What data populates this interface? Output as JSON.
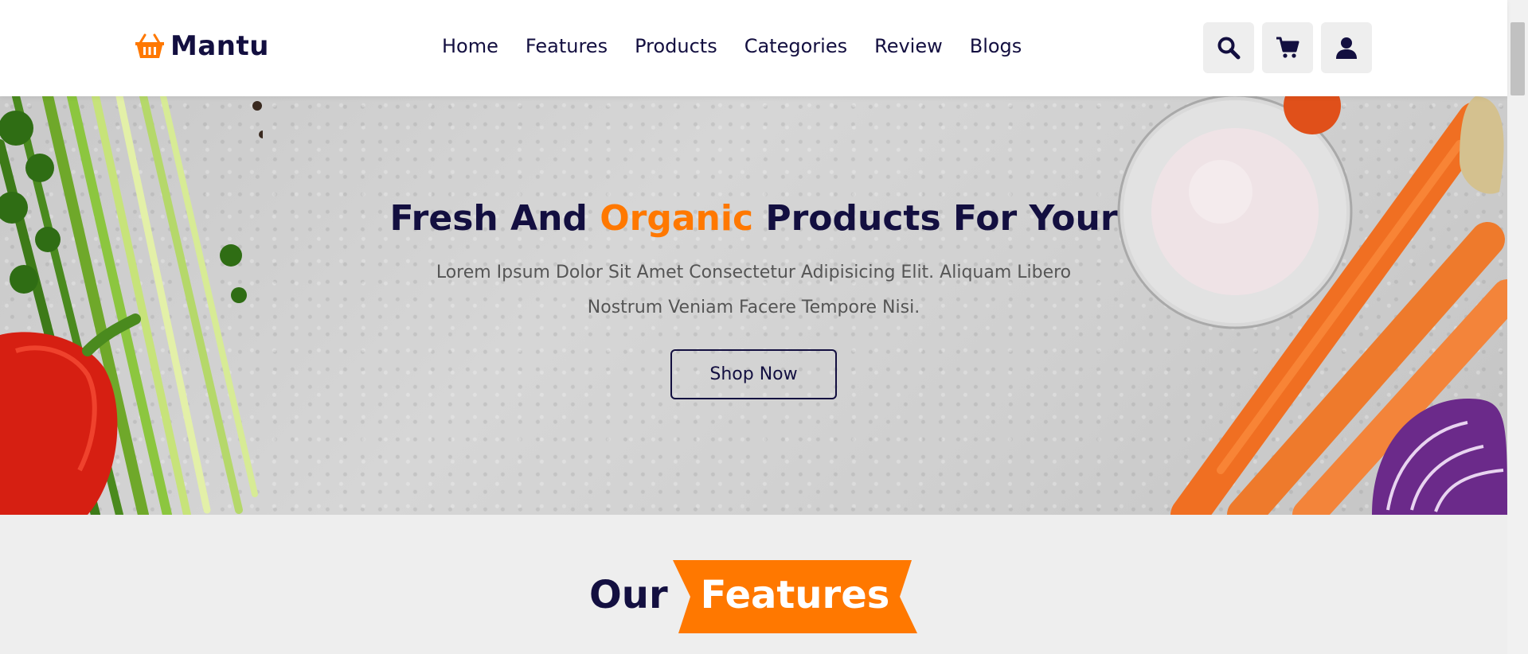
{
  "header": {
    "brand": "Mantu",
    "nav": [
      "Home",
      "Features",
      "Products",
      "Categories",
      "Review",
      "Blogs"
    ],
    "icons": [
      "search-icon",
      "cart-icon",
      "user-icon"
    ]
  },
  "hero": {
    "title_before": "Fresh And ",
    "title_accent": "Organic",
    "title_after": " Products For Your",
    "text": "Lorem Ipsum Dolor Sit Amet Consectetur Adipisicing Elit. Aliquam Libero Nostrum Veniam Facere Tempore Nisi.",
    "button": "Shop Now"
  },
  "features": {
    "heading_plain": "Our",
    "heading_highlight": "Features"
  },
  "colors": {
    "accent": "#ff7800",
    "primary": "#130f40",
    "text_light": "#555555",
    "background": "#eeeeee"
  }
}
